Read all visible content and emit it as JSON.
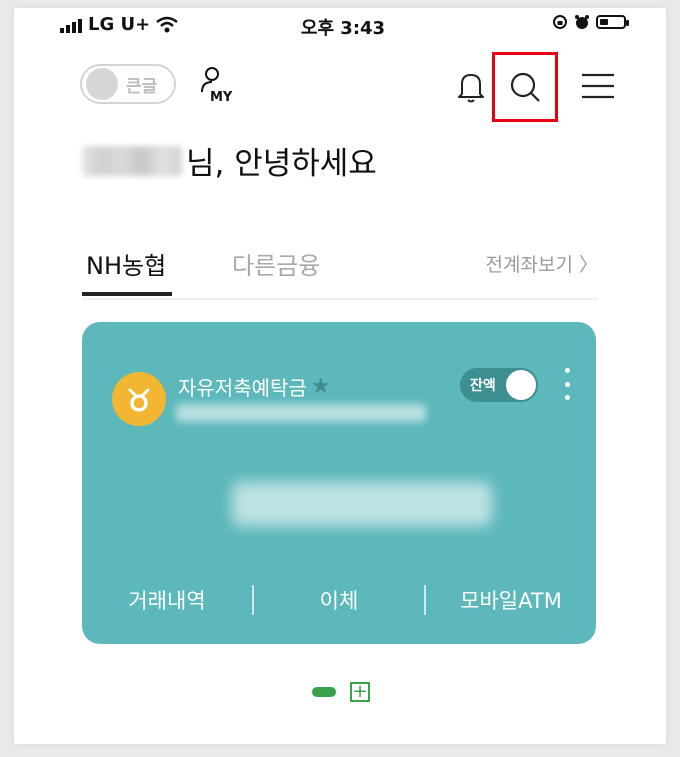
{
  "status_bar": {
    "carrier": "LG U+",
    "time": "오후 3:43"
  },
  "header": {
    "big_font_label": "큰글",
    "my_label": "MY"
  },
  "greeting": {
    "suffix": "님, 안녕하세요"
  },
  "tabs": {
    "active": "NH농협",
    "other": "다른금융",
    "all_accounts": "전계좌보기 〉"
  },
  "card": {
    "account_name": "자유저축예탁금",
    "balance_toggle_label": "잔액",
    "actions": [
      "거래내역",
      "이체",
      "모바일ATM"
    ],
    "color": "#5cb8bb"
  },
  "pager": {
    "add_symbol": "+"
  },
  "colors": {
    "highlight": "#e60012",
    "accent_green": "#3aa24a",
    "icon_yellow": "#f2b632"
  }
}
